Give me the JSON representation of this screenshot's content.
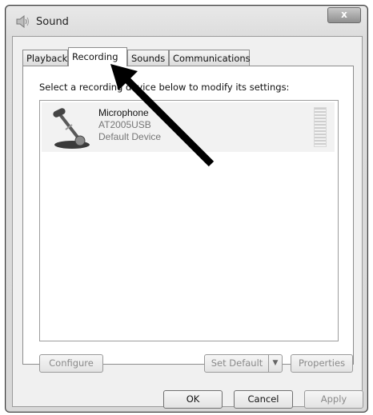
{
  "window": {
    "title": "Sound",
    "close_glyph": "x"
  },
  "tabs": [
    {
      "label": "Playback",
      "active": false
    },
    {
      "label": "Recording",
      "active": true
    },
    {
      "label": "Sounds",
      "active": false
    },
    {
      "label": "Communications",
      "active": false
    }
  ],
  "panel": {
    "instruction": "Select a recording device below to modify its settings:",
    "devices": [
      {
        "name": "Microphone",
        "model": "AT2005USB",
        "status": "Default Device",
        "icon": "microphone-icon"
      }
    ],
    "buttons": {
      "configure": "Configure",
      "set_default": "Set Default",
      "properties": "Properties"
    }
  },
  "footer": {
    "ok": "OK",
    "cancel": "Cancel",
    "apply": "Apply"
  },
  "annotation": {
    "icon": "arrow-icon",
    "color": "#000000"
  }
}
